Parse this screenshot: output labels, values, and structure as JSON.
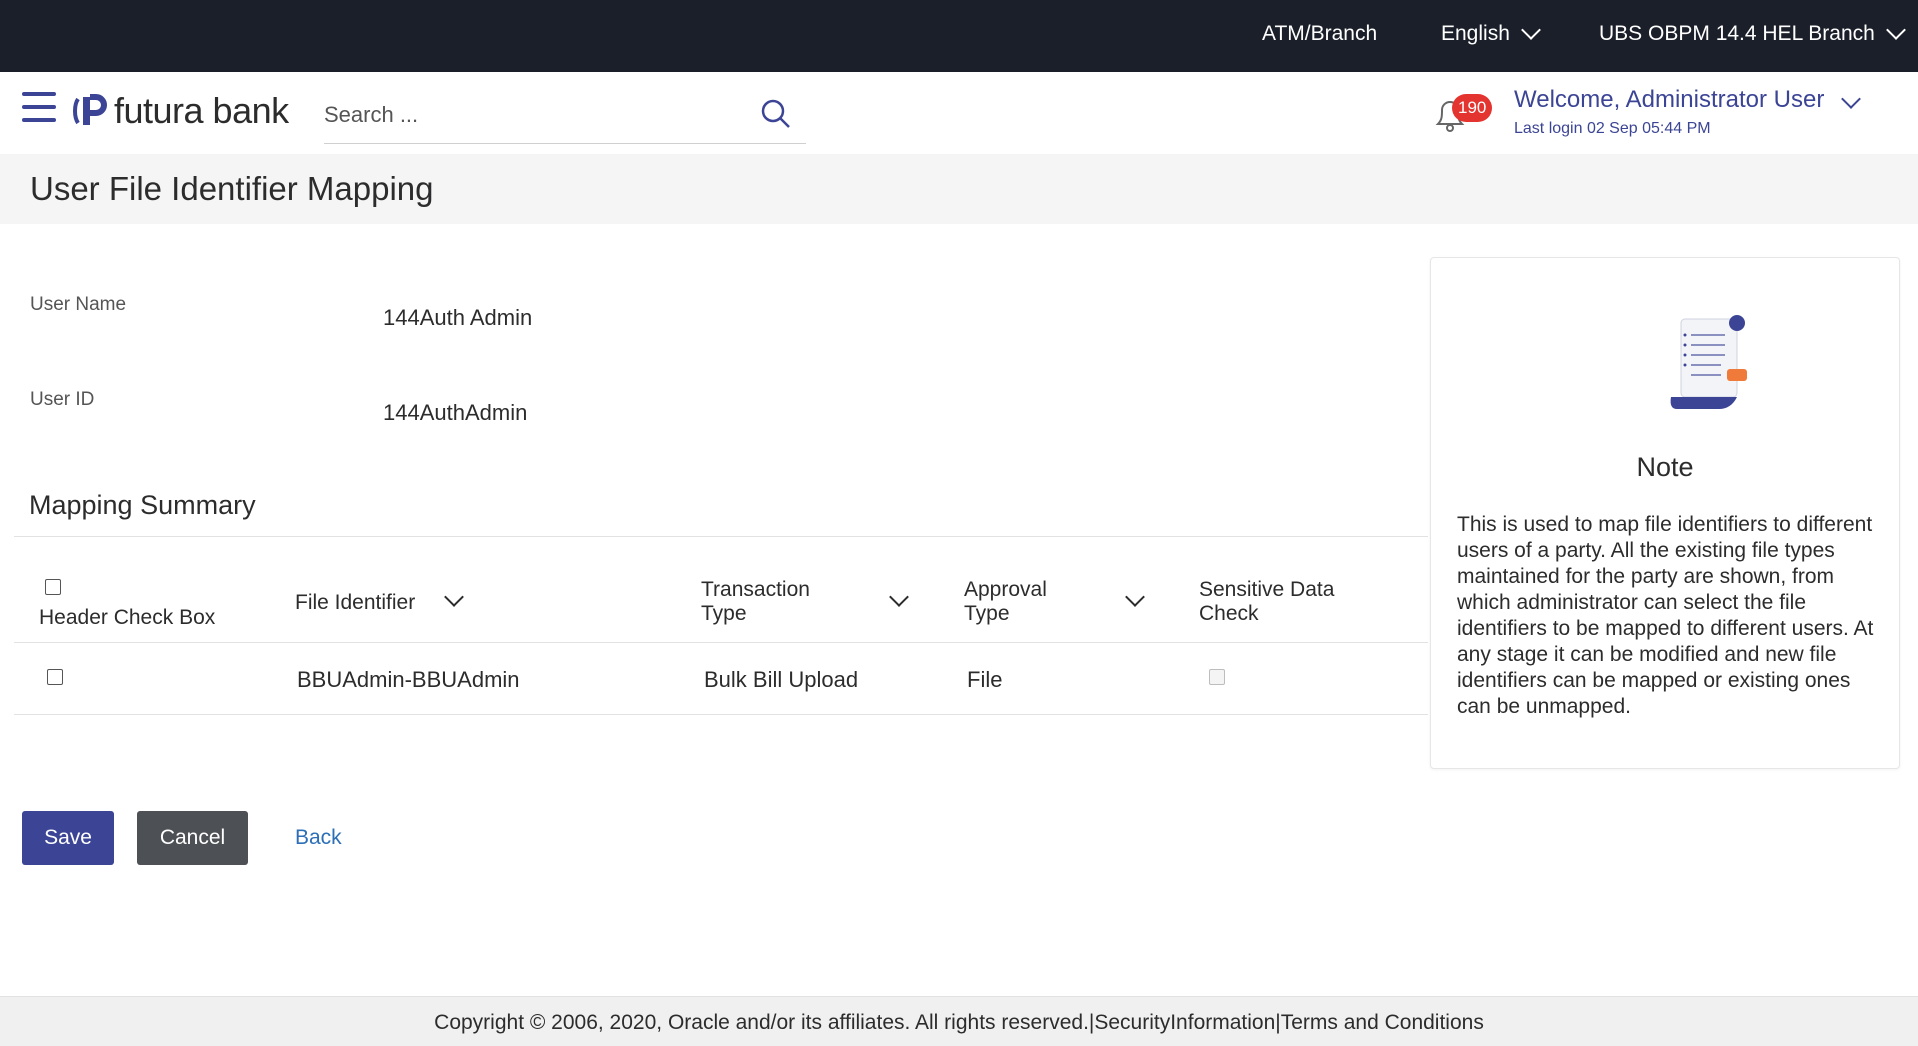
{
  "topbar": {
    "atm_branch": "ATM/Branch",
    "language": "English",
    "branch": "UBS OBPM 14.4 HEL Branch"
  },
  "header": {
    "logo_text": "futura bank",
    "search_placeholder": "Search ...",
    "notification_count": "190",
    "welcome": "Welcome, Administrator User",
    "last_login": "Last login 02 Sep 05:44 PM"
  },
  "page": {
    "title": "User File Identifier Mapping"
  },
  "user": {
    "name_label": "User Name",
    "name_value": "144Auth Admin",
    "id_label": "User ID",
    "id_value": "144AuthAdmin"
  },
  "mapping": {
    "section_title": "Mapping Summary",
    "columns": {
      "header_check": "Header Check Box",
      "file_identifier": "File Identifier",
      "transaction_type": "Transaction Type",
      "approval_type": "Approval Type",
      "sensitive_data": "Sensitive Data Check"
    },
    "rows": [
      {
        "file_identifier": "BBUAdmin-BBUAdmin",
        "transaction_type": "Bulk Bill Upload",
        "approval_type": "File",
        "checked": false,
        "sensitive": false
      }
    ]
  },
  "note": {
    "title": "Note",
    "text": "This is used to map file identifiers to different users of a party. All the existing file types maintained for the party are shown, from which administrator can select the file identifiers to be mapped to different users. At any stage it can be modified and new file identifiers can be mapped or existing ones can be unmapped."
  },
  "actions": {
    "save": "Save",
    "cancel": "Cancel",
    "back": "Back"
  },
  "footer": {
    "copyright": "Copyright © 2006, 2020, Oracle and/or its affiliates. All rights reserved.|SecurityInformation|Terms and Conditions"
  },
  "colors": {
    "primary": "#3c4595",
    "topbar": "#1b1f2a",
    "badge": "#e3342f",
    "link": "#2c6fb7"
  }
}
